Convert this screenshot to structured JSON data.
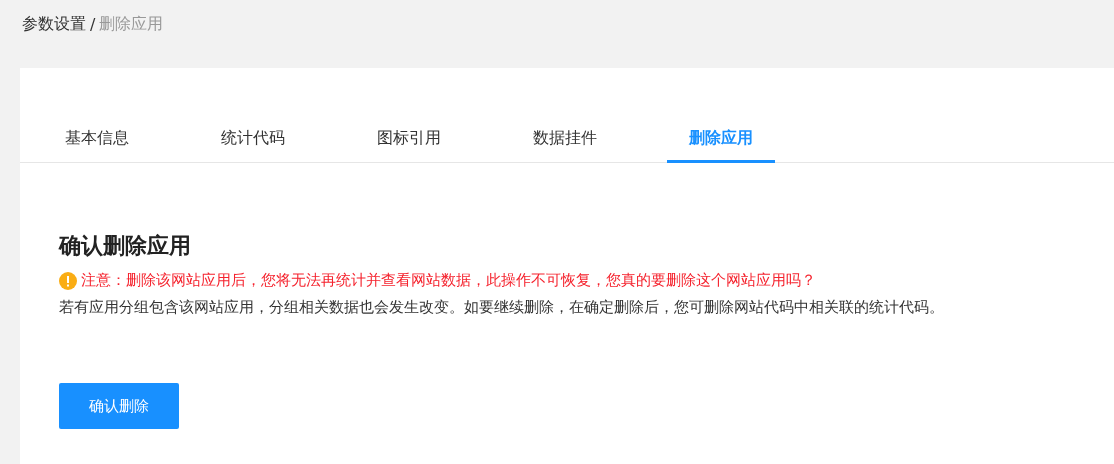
{
  "breadcrumb": [
    {
      "label": "参数设置",
      "current": false
    },
    {
      "label": "删除应用",
      "current": true
    }
  ],
  "breadcrumb_separator": "/",
  "tabs": [
    {
      "label": "基本信息",
      "selected": false
    },
    {
      "label": "统计代码",
      "selected": false
    },
    {
      "label": "图标引用",
      "selected": false
    },
    {
      "label": "数据挂件",
      "selected": false
    },
    {
      "label": "删除应用",
      "selected": true
    }
  ],
  "section": {
    "title": "确认删除应用",
    "warning": "注意：删除该网站应用后，您将无法再统计并查看网站数据，此操作不可恢复，您真的要删除这个网站应用吗？",
    "note": "若有应用分组包含该网站应用，分组相关数据也会发生改变。如要继续删除，在确定删除后，您可删除网站代码中相关联的统计代码。",
    "button": "确认删除"
  }
}
